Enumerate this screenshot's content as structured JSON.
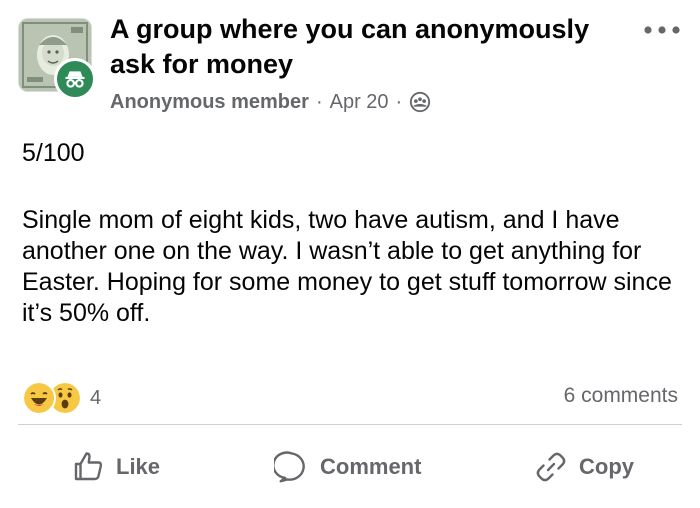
{
  "post": {
    "group_title": "A group where you can anonymously ask for money",
    "author": "Anonymous member",
    "separator": "·",
    "date": "Apr 20",
    "privacy_icon": "group-members-icon",
    "more_icon": "more-horizontal-icon",
    "counter": "5/100",
    "text": "Single mom of eight kids, two have autism, and I have another one on the way. I wasn’t able to get anything for Easter. Hoping for some money to get stuff tomorrow since it’s 50% off."
  },
  "reactions": {
    "icons": [
      "haha-reaction-icon",
      "wow-reaction-icon"
    ],
    "count": "4",
    "comments": "6 comments"
  },
  "actions": {
    "like": "Like",
    "comment": "Comment",
    "copy": "Copy"
  },
  "colors": {
    "text": "#050505",
    "secondary_text": "#65676b",
    "badge_green": "#2e8b57",
    "reaction_yellow": "#f7c843",
    "divider": "#ced0d4"
  }
}
